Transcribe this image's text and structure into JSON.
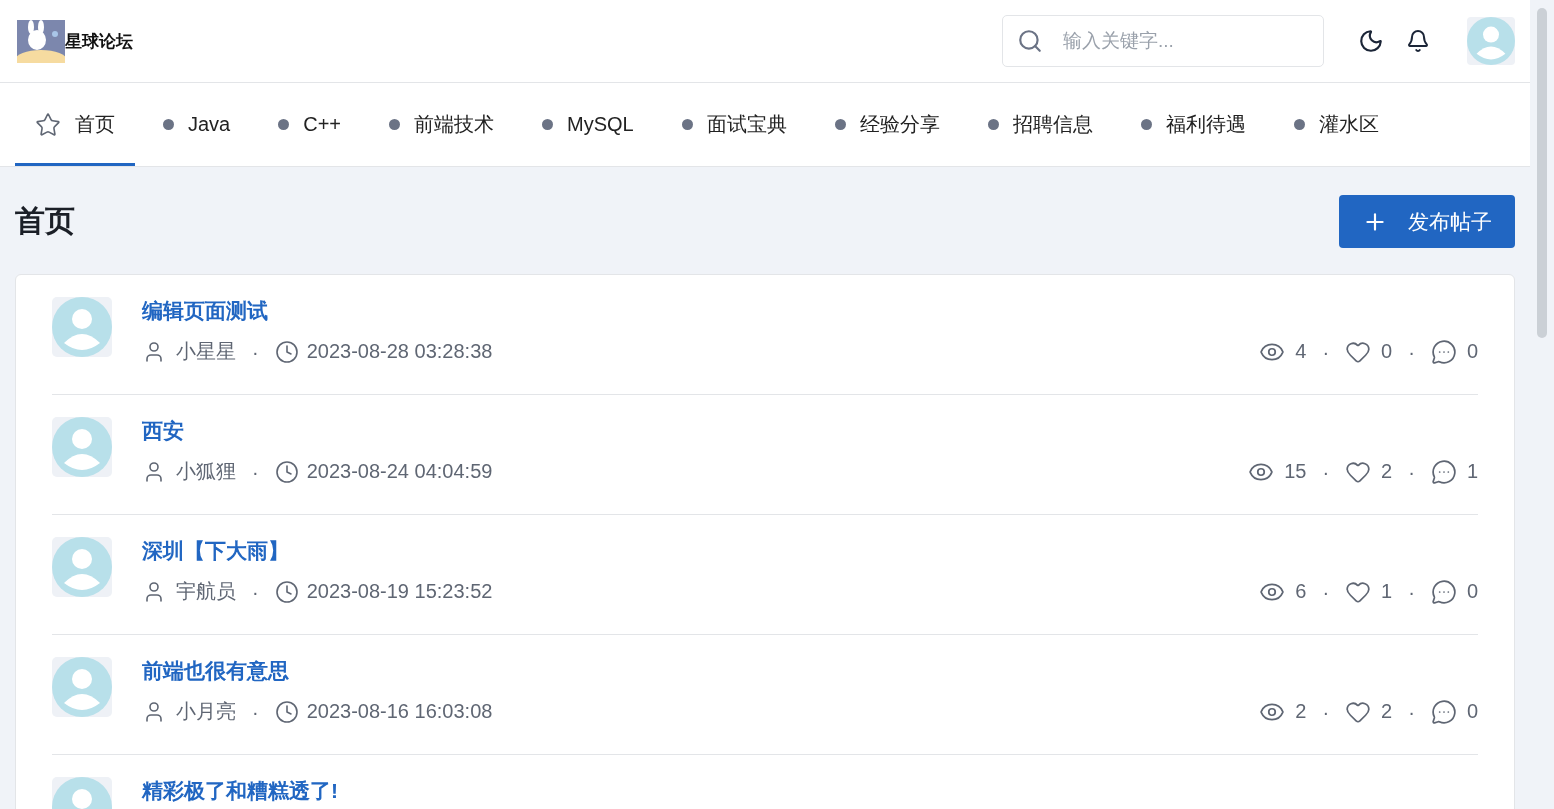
{
  "header": {
    "site_name": "星球论坛",
    "search": {
      "placeholder": "输入关键字..."
    }
  },
  "nav": [
    {
      "label": "首页",
      "kind": "home",
      "selected": true
    },
    {
      "label": "Java",
      "kind": "category",
      "selected": false
    },
    {
      "label": "C++",
      "kind": "category",
      "selected": false
    },
    {
      "label": "前端技术",
      "kind": "category",
      "selected": false
    },
    {
      "label": "MySQL",
      "kind": "category",
      "selected": false
    },
    {
      "label": "面试宝典",
      "kind": "category",
      "selected": false
    },
    {
      "label": "经验分享",
      "kind": "category",
      "selected": false
    },
    {
      "label": "招聘信息",
      "kind": "category",
      "selected": false
    },
    {
      "label": "福利待遇",
      "kind": "category",
      "selected": false
    },
    {
      "label": "灌水区",
      "kind": "category",
      "selected": false
    }
  ],
  "page_title": "首页",
  "new_post_button": "发布帖子",
  "posts": [
    {
      "title": "编辑页面测试",
      "author": "小星星",
      "time": "2023-08-28 03:28:38",
      "views": "4",
      "likes": "0",
      "comments": "0",
      "separators": [
        "·",
        "·",
        "·"
      ]
    },
    {
      "title": "西安",
      "author": "小狐狸",
      "time": "2023-08-24 04:04:59",
      "views": "15",
      "likes": "2",
      "comments": "1",
      "separators": [
        "·",
        "·",
        "·"
      ]
    },
    {
      "title": "深圳【下大雨】",
      "author": "宇航员",
      "time": "2023-08-19 15:23:52",
      "views": "6",
      "likes": "1",
      "comments": "0",
      "separators": [
        "·",
        "·",
        "·"
      ]
    },
    {
      "title": "前端也很有意思",
      "author": "小月亮",
      "time": "2023-08-16 16:03:08",
      "views": "2",
      "likes": "2",
      "comments": "0",
      "separators": [
        "·",
        "·",
        "·"
      ]
    },
    {
      "title": "精彩极了和糟糕透了!"
    }
  ]
}
